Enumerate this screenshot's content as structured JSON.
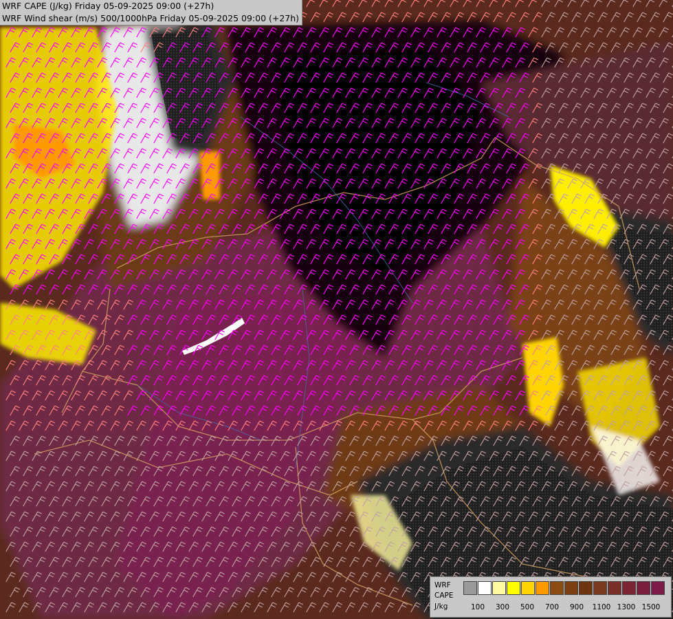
{
  "header": {
    "line1": "WRF CAPE (J/kg) Friday 05-09-2025 09:00 (+27h)",
    "line2": "WRF Wind shear (m/s) 500/1000hPa Friday 05-09-2025 09:00 (+27h)"
  },
  "legend": {
    "label1": "WRF",
    "label2": "CAPE",
    "label3": "J/kg",
    "colors": [
      "#9a9a9a",
      "#ffffff",
      "#fff9a0",
      "#ffff00",
      "#ffd400",
      "#ff9900",
      "#8b4c12",
      "#7a3e12",
      "#6e3410",
      "#7a3a22",
      "#7a2e2a",
      "#7a2434",
      "#7a1e3e",
      "#7c1a48",
      "#7e1650",
      "#801258",
      "#7a0f5a"
    ],
    "ticks": [
      "100",
      "300",
      "500",
      "700",
      "900",
      "1100",
      "1300",
      "1500"
    ]
  },
  "map_colors": {
    "low_cape_grey": "#2a2a2a",
    "brown": "#7a3e12",
    "maroon": "#6b2a3a",
    "purple": "#7a1e55",
    "yellow": "#ffee00",
    "orange": "#ff9900",
    "barb_magenta": "#ff00ff",
    "barb_pink": "#ff8080",
    "barb_grey": "#c0a0a0",
    "border_tan": "#d2a060"
  }
}
